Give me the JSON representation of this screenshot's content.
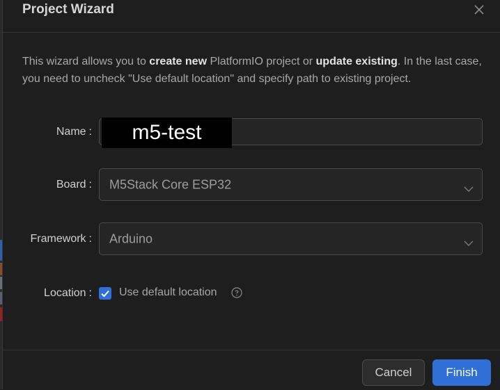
{
  "dialog": {
    "title": "Project Wizard"
  },
  "intro": {
    "part1": "This wizard allows you to ",
    "bold1": "create new",
    "part2": " PlatformIO project or ",
    "bold2": "update existing",
    "part3": ". In the last case, you need to uncheck \"Use default location\" and specify path to existing project."
  },
  "form": {
    "name": {
      "label": "Name",
      "value": "m5-test"
    },
    "board": {
      "label": "Board",
      "value": "M5Stack Core ESP32"
    },
    "framework": {
      "label": "Framework",
      "value": "Arduino"
    },
    "location": {
      "label": "Location",
      "checkbox_label": "Use default location",
      "checked": true
    },
    "label_suffix": ":"
  },
  "footer": {
    "cancel_label": "Cancel",
    "finish_label": "Finish"
  },
  "colors": {
    "accent": "#2f6fd6",
    "background": "#1e1e1f"
  },
  "icons": {
    "close": "close-icon",
    "chevron": "chevron-down-icon",
    "check": "check-icon",
    "help": "help-circle-icon"
  }
}
